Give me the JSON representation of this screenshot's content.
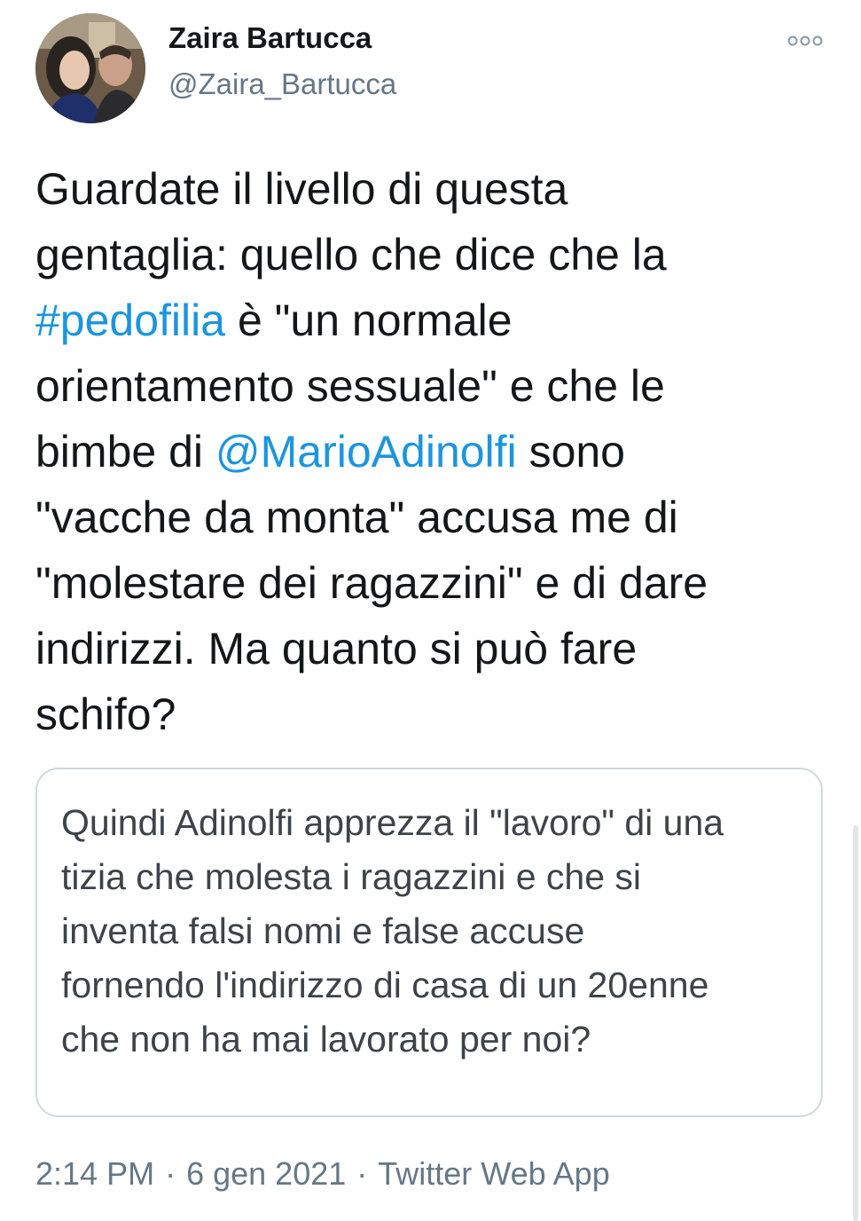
{
  "tweet": {
    "author": {
      "display_name": "Zaira Bartucca",
      "handle": "@Zaira_Bartucca",
      "avatar_icon": "profile-photo-avatar"
    },
    "more_icon": "more-options-icon",
    "text_lines": [
      [
        {
          "t": "Guardate il livello di questa"
        }
      ],
      [
        {
          "t": "gentaglia: quello che dice che la"
        }
      ],
      [
        {
          "t": "#pedofilia",
          "link": true
        },
        {
          "t": " è \"un normale"
        }
      ],
      [
        {
          "t": "orientamento sessuale\" e che le"
        }
      ],
      [
        {
          "t": "bimbe di "
        },
        {
          "t": "@MarioAdinolfi",
          "link": true
        },
        {
          "t": " sono"
        }
      ],
      [
        {
          "t": "\"vacche da monta\" accusa me di"
        }
      ],
      [
        {
          "t": "\"molestare dei ragazzini\" e di dare"
        }
      ],
      [
        {
          "t": "indirizzi. Ma quanto si può fare"
        }
      ],
      [
        {
          "t": "schifo?"
        }
      ]
    ],
    "quoted_lines": [
      "Quindi Adinolfi apprezza il \"lavoro\" di una",
      "tizia che molesta i ragazzini e che si",
      "inventa falsi nomi e false accuse",
      "fornendo l'indirizzo di casa di un 20enne",
      "che non ha mai lavorato per noi?"
    ],
    "meta": {
      "time": "2:14 PM",
      "date": "6 gen 2021",
      "separator": "·",
      "source": "Twitter Web App"
    }
  },
  "colors": {
    "link": "#1b95e0",
    "text": "#14171a",
    "secondary": "#657786",
    "border": "#cfd9de"
  }
}
